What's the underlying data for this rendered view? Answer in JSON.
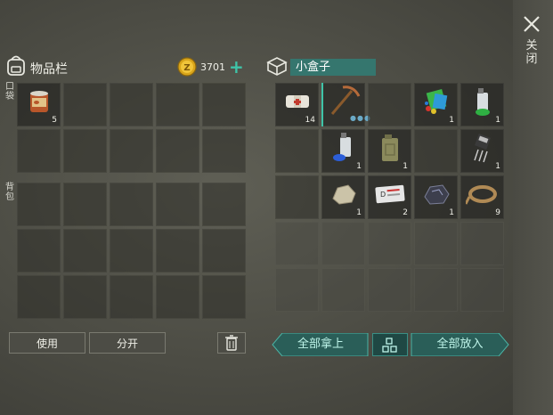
{
  "close": {
    "label": "关闭",
    "icon": "close-icon"
  },
  "inventory": {
    "title": "物品栏",
    "coins": "3701",
    "pocket_label": "口袋",
    "backpack_label": "背包",
    "pocket_slots": [
      {
        "item": "canned-food",
        "qty": "5"
      },
      {},
      {},
      {},
      {},
      {},
      {},
      {},
      {},
      {}
    ],
    "backpack_slots": 15
  },
  "container": {
    "name": "小盒子",
    "slots": [
      {
        "item": "bandage",
        "qty": "14"
      },
      {
        "item": "pickaxe",
        "qty": ""
      },
      {},
      {
        "item": "fishing-bait",
        "qty": "1"
      },
      {
        "item": "spray-can-green",
        "qty": "1"
      },
      {},
      {
        "item": "spray-can-blue",
        "qty": "1"
      },
      {
        "item": "jerrycan",
        "qty": "1"
      },
      {},
      {
        "item": "electronic-component",
        "qty": "1"
      },
      {},
      {
        "item": "stone",
        "qty": "1"
      },
      {
        "item": "id-card",
        "qty": "2"
      },
      {
        "item": "coal-ore",
        "qty": "1"
      },
      {
        "item": "rope",
        "qty": "9"
      }
    ],
    "dim_slots": 10
  },
  "buttons": {
    "use": "使用",
    "split": "分开",
    "take_all": "全部拿上",
    "put_all": "全部放入"
  },
  "colors": {
    "accent": "#3fc4a8",
    "name_field": "#35766e",
    "arrow_button": "#2a5e58"
  }
}
